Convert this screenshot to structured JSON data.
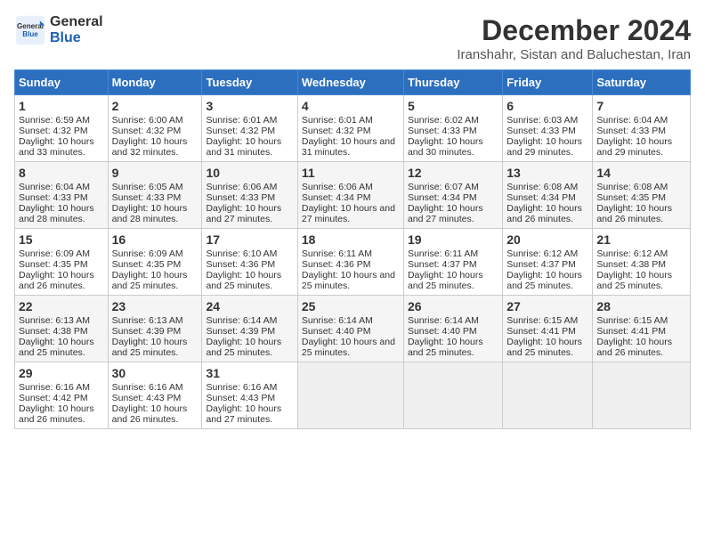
{
  "logo": {
    "line1": "General",
    "line2": "Blue"
  },
  "title": "December 2024",
  "subtitle": "Iranshahr, Sistan and Baluchestan, Iran",
  "days_of_week": [
    "Sunday",
    "Monday",
    "Tuesday",
    "Wednesday",
    "Thursday",
    "Friday",
    "Saturday"
  ],
  "weeks": [
    [
      {
        "day": 1,
        "sunrise": "6:59 AM",
        "sunset": "4:32 PM",
        "daylight": "10 hours and 33 minutes."
      },
      {
        "day": 2,
        "sunrise": "6:00 AM",
        "sunset": "4:32 PM",
        "daylight": "10 hours and 32 minutes."
      },
      {
        "day": 3,
        "sunrise": "6:01 AM",
        "sunset": "4:32 PM",
        "daylight": "10 hours and 31 minutes."
      },
      {
        "day": 4,
        "sunrise": "6:01 AM",
        "sunset": "4:32 PM",
        "daylight": "10 hours and 31 minutes."
      },
      {
        "day": 5,
        "sunrise": "6:02 AM",
        "sunset": "4:33 PM",
        "daylight": "10 hours and 30 minutes."
      },
      {
        "day": 6,
        "sunrise": "6:03 AM",
        "sunset": "4:33 PM",
        "daylight": "10 hours and 29 minutes."
      },
      {
        "day": 7,
        "sunrise": "6:04 AM",
        "sunset": "4:33 PM",
        "daylight": "10 hours and 29 minutes."
      }
    ],
    [
      {
        "day": 8,
        "sunrise": "6:04 AM",
        "sunset": "4:33 PM",
        "daylight": "10 hours and 28 minutes."
      },
      {
        "day": 9,
        "sunrise": "6:05 AM",
        "sunset": "4:33 PM",
        "daylight": "10 hours and 28 minutes."
      },
      {
        "day": 10,
        "sunrise": "6:06 AM",
        "sunset": "4:33 PM",
        "daylight": "10 hours and 27 minutes."
      },
      {
        "day": 11,
        "sunrise": "6:06 AM",
        "sunset": "4:34 PM",
        "daylight": "10 hours and 27 minutes."
      },
      {
        "day": 12,
        "sunrise": "6:07 AM",
        "sunset": "4:34 PM",
        "daylight": "10 hours and 27 minutes."
      },
      {
        "day": 13,
        "sunrise": "6:08 AM",
        "sunset": "4:34 PM",
        "daylight": "10 hours and 26 minutes."
      },
      {
        "day": 14,
        "sunrise": "6:08 AM",
        "sunset": "4:35 PM",
        "daylight": "10 hours and 26 minutes."
      }
    ],
    [
      {
        "day": 15,
        "sunrise": "6:09 AM",
        "sunset": "4:35 PM",
        "daylight": "10 hours and 26 minutes."
      },
      {
        "day": 16,
        "sunrise": "6:09 AM",
        "sunset": "4:35 PM",
        "daylight": "10 hours and 25 minutes."
      },
      {
        "day": 17,
        "sunrise": "6:10 AM",
        "sunset": "4:36 PM",
        "daylight": "10 hours and 25 minutes."
      },
      {
        "day": 18,
        "sunrise": "6:11 AM",
        "sunset": "4:36 PM",
        "daylight": "10 hours and 25 minutes."
      },
      {
        "day": 19,
        "sunrise": "6:11 AM",
        "sunset": "4:37 PM",
        "daylight": "10 hours and 25 minutes."
      },
      {
        "day": 20,
        "sunrise": "6:12 AM",
        "sunset": "4:37 PM",
        "daylight": "10 hours and 25 minutes."
      },
      {
        "day": 21,
        "sunrise": "6:12 AM",
        "sunset": "4:38 PM",
        "daylight": "10 hours and 25 minutes."
      }
    ],
    [
      {
        "day": 22,
        "sunrise": "6:13 AM",
        "sunset": "4:38 PM",
        "daylight": "10 hours and 25 minutes."
      },
      {
        "day": 23,
        "sunrise": "6:13 AM",
        "sunset": "4:39 PM",
        "daylight": "10 hours and 25 minutes."
      },
      {
        "day": 24,
        "sunrise": "6:14 AM",
        "sunset": "4:39 PM",
        "daylight": "10 hours and 25 minutes."
      },
      {
        "day": 25,
        "sunrise": "6:14 AM",
        "sunset": "4:40 PM",
        "daylight": "10 hours and 25 minutes."
      },
      {
        "day": 26,
        "sunrise": "6:14 AM",
        "sunset": "4:40 PM",
        "daylight": "10 hours and 25 minutes."
      },
      {
        "day": 27,
        "sunrise": "6:15 AM",
        "sunset": "4:41 PM",
        "daylight": "10 hours and 25 minutes."
      },
      {
        "day": 28,
        "sunrise": "6:15 AM",
        "sunset": "4:41 PM",
        "daylight": "10 hours and 26 minutes."
      }
    ],
    [
      {
        "day": 29,
        "sunrise": "6:16 AM",
        "sunset": "4:42 PM",
        "daylight": "10 hours and 26 minutes."
      },
      {
        "day": 30,
        "sunrise": "6:16 AM",
        "sunset": "4:43 PM",
        "daylight": "10 hours and 26 minutes."
      },
      {
        "day": 31,
        "sunrise": "6:16 AM",
        "sunset": "4:43 PM",
        "daylight": "10 hours and 27 minutes."
      },
      null,
      null,
      null,
      null
    ]
  ]
}
